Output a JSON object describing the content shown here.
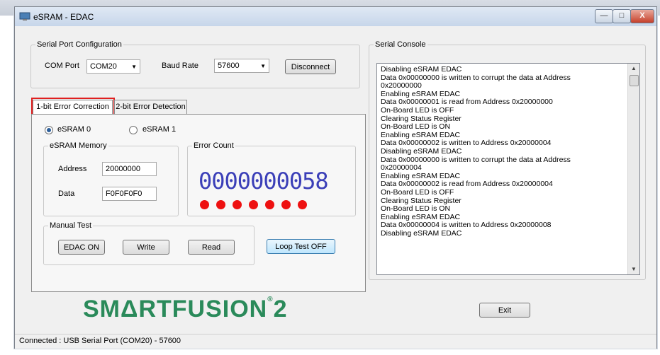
{
  "window": {
    "title": "eSRAM - EDAC",
    "minimize": "—",
    "maximize": "□",
    "close": "X"
  },
  "serial_port_config": {
    "legend": "Serial Port Configuration",
    "com_port_label": "COM Port",
    "com_port_value": "COM20",
    "baud_rate_label": "Baud Rate",
    "baud_rate_value": "57600",
    "disconnect_label": "Disconnect"
  },
  "tabs": [
    {
      "label": "1-bit Error Correction",
      "selected": true
    },
    {
      "label": "2-bit Error Detection",
      "selected": false
    }
  ],
  "esram_select": {
    "option0": "eSRAM 0",
    "option1": "eSRAM 1",
    "selected": "eSRAM 0"
  },
  "memory": {
    "legend": "eSRAM Memory",
    "address_label": "Address",
    "address_value": "20000000",
    "data_label": "Data",
    "data_value": "F0F0F0F0"
  },
  "error_count": {
    "legend": "Error Count",
    "value": "0000000058",
    "led_count": 7,
    "led_color": "#ee1111",
    "digit_color": "#3b3fb8"
  },
  "manual_test": {
    "legend": "Manual Test",
    "edac_label": "EDAC ON",
    "write_label": "Write",
    "read_label": "Read",
    "loop_label": "Loop Test OFF"
  },
  "console": {
    "legend": "Serial Console",
    "lines": [
      "Disabling eSRAM EDAC",
      "Data 0x00000000 is written to corrupt the data at Address",
      "0x20000000",
      "Enabling eSRAM EDAC",
      "Data 0x00000001 is read from Address 0x20000000",
      "On-Board LED is OFF",
      "Clearing Status Register",
      "On-Board LED is ON",
      "Enabling eSRAM EDAC",
      "Data 0x00000002 is written to Address 0x20000004",
      "Disabling eSRAM EDAC",
      "Data 0x00000000 is written to corrupt the data at Address",
      "0x20000004",
      "Enabling eSRAM EDAC",
      "Data 0x00000002 is read from Address 0x20000004",
      "On-Board LED is OFF",
      "Clearing Status Register",
      "On-Board LED is ON",
      "Enabling eSRAM EDAC",
      "Data 0x00000004 is written to Address 0x20000008",
      "Disabling eSRAM EDAC"
    ]
  },
  "logo": {
    "text": "SMΔRTFUSION",
    "suffix": "2",
    "color": "#2a8a5a"
  },
  "exit_label": "Exit",
  "status_bar": "Connected : USB Serial Port (COM20) - 57600"
}
